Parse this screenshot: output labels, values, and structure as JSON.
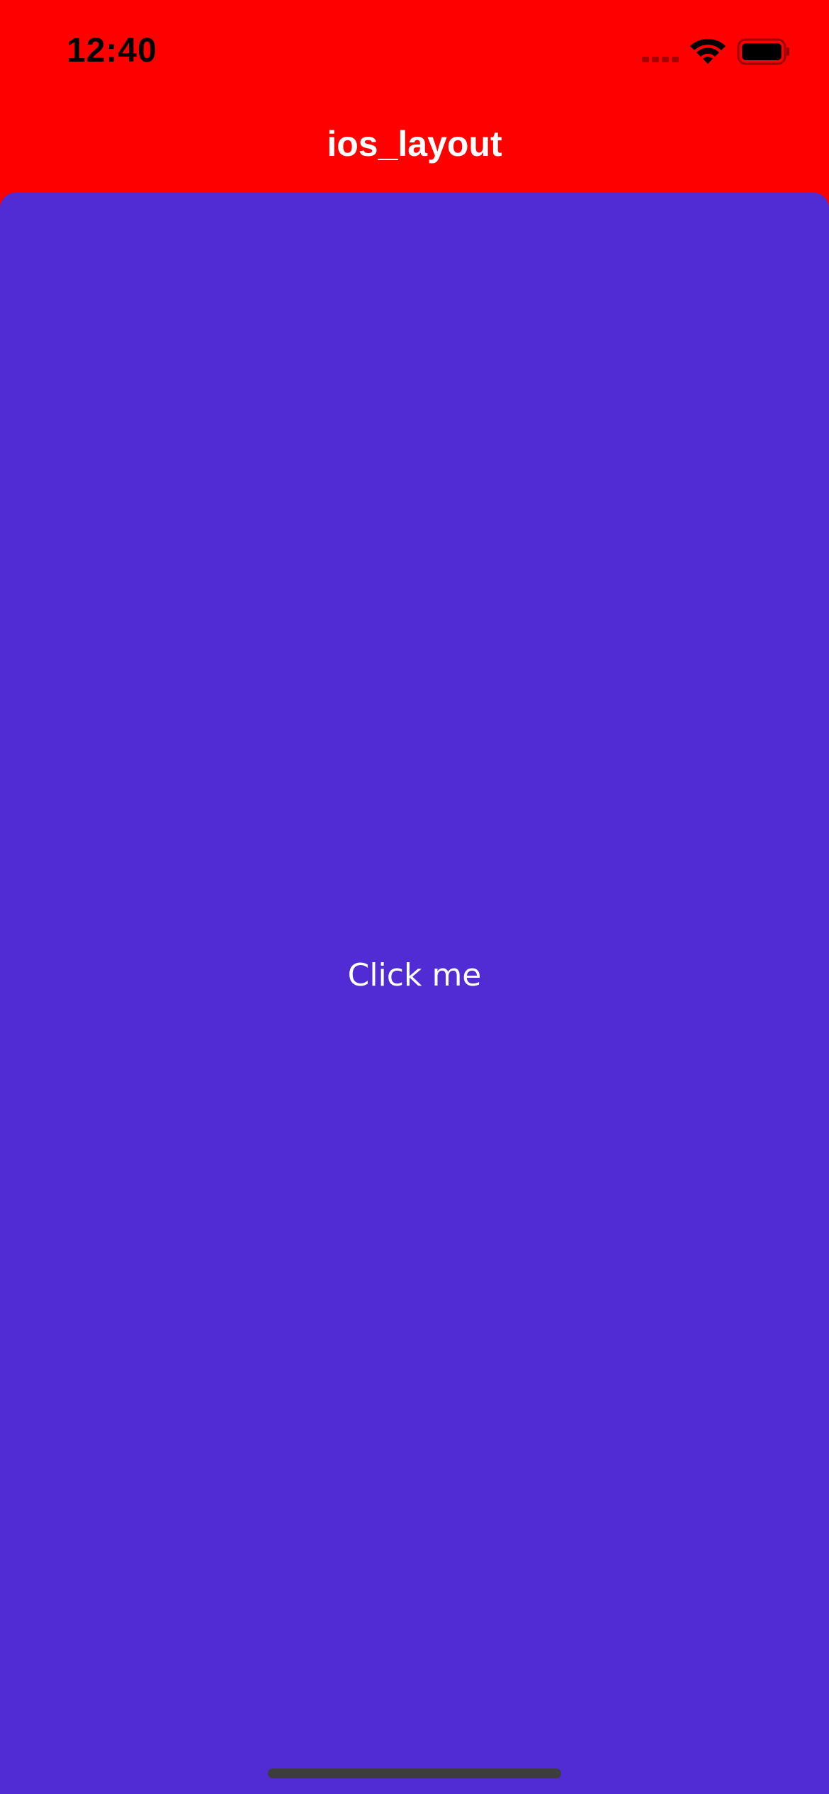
{
  "status_bar": {
    "time": "12:40",
    "signal_icon": "cellular-signal-icon",
    "wifi_icon": "wifi-icon",
    "battery_icon": "battery-icon"
  },
  "nav": {
    "title": "ios_layout"
  },
  "main": {
    "button_label": "Click me"
  },
  "colors": {
    "header_background": "#ff0000",
    "content_background": "#512bd4",
    "text_on_primary": "#ffffff"
  }
}
